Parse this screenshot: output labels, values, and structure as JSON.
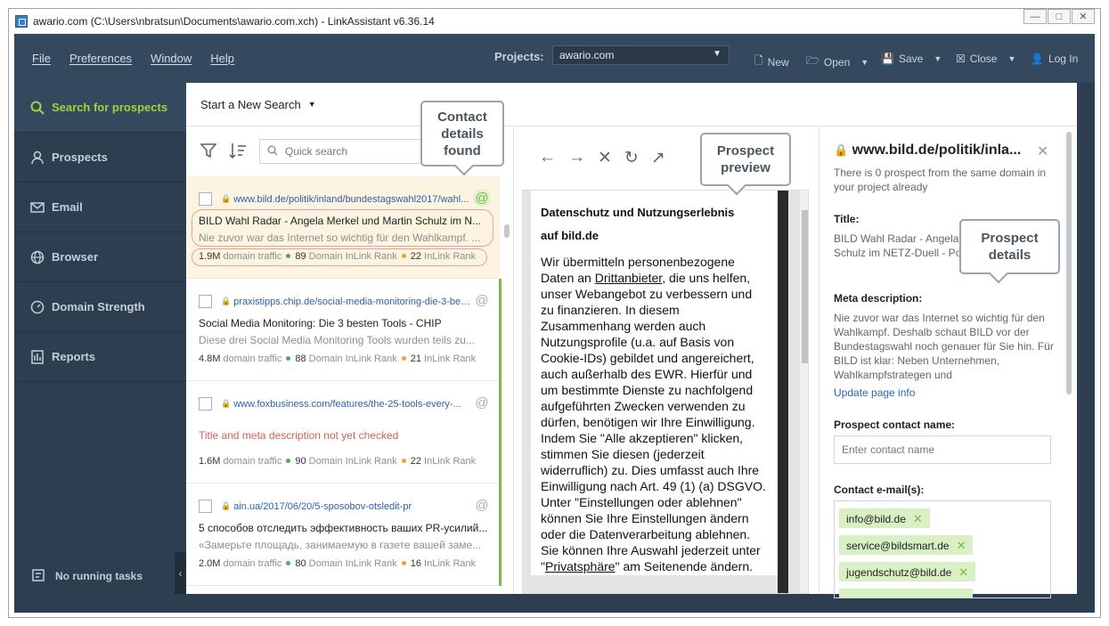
{
  "window": {
    "title": "awario.com (C:\\Users\\nbratsun\\Documents\\awario.com.xch) - LinkAssistant v6.36.14",
    "controls": [
      "min",
      "max",
      "close"
    ]
  },
  "menubar": {
    "items": [
      "File",
      "Preferences",
      "Window",
      "Help"
    ],
    "projects_label": "Projects:",
    "project_value": "awario.com",
    "new": "New",
    "open": "Open",
    "save": "Save",
    "close": "Close",
    "login": "Log In"
  },
  "sidebar": {
    "items": [
      {
        "label": "Search for prospects",
        "icon": "search-icon"
      },
      {
        "label": "Prospects",
        "icon": "user-icon"
      },
      {
        "label": "Email",
        "icon": "mail-icon"
      },
      {
        "label": "Browser",
        "icon": "globe-icon"
      },
      {
        "label": "Domain Strength",
        "icon": "gauge-icon"
      },
      {
        "label": "Reports",
        "icon": "report-icon"
      }
    ],
    "tasks": "No running tasks"
  },
  "search": {
    "new_search": "Start a New Search",
    "placeholder": "Quick search"
  },
  "prospects": [
    {
      "url": "www.bild.de/politik/inland/bundestagswahl2017/wahl...",
      "title": "BILD Wahl Radar - Angela Merkel und Martin Schulz im N...",
      "desc": "Nie zuvor war das Internet so wichtig für den Wahlkampf. ...",
      "traffic": "1.9M",
      "traffic_lbl": "domain traffic",
      "dir": "89",
      "dir_lbl": "Domain InLink Rank",
      "ilr": "22",
      "ilr_lbl": "InLink Rank"
    },
    {
      "url": "praxistipps.chip.de/social-media-monitoring-die-3-best...",
      "title": "Social Media Monitoring: Die 3 besten Tools - CHIP",
      "desc": "Diese drei Social Media Monitoring Tools wurden teils zu...",
      "traffic": "4.8M",
      "traffic_lbl": "domain traffic",
      "dir": "88",
      "dir_lbl": "Domain InLink Rank",
      "ilr": "21",
      "ilr_lbl": "InLink Rank"
    },
    {
      "url": "www.foxbusiness.com/features/the-25-tools-every-...",
      "notchecked": "Title and meta description not yet checked",
      "traffic": "1.6M",
      "traffic_lbl": "domain traffic",
      "dir": "90",
      "dir_lbl": "Domain InLink Rank",
      "ilr": "22",
      "ilr_lbl": "InLink Rank"
    },
    {
      "url": "ain.ua/2017/06/20/5-sposobov-otsledit-pr",
      "title": "5 способов отследить эффективность ваших PR-усилий...",
      "desc": "«Замерьте площадь, занимаемую в газете вашей заме...",
      "traffic": "2.0M",
      "traffic_lbl": "domain traffic",
      "dir": "80",
      "dir_lbl": "Domain InLink Rank",
      "ilr": "16",
      "ilr_lbl": "InLink Rank"
    }
  ],
  "preview": {
    "heading1": "Datenschutz und Nutzungserlebnis",
    "heading2": "auf bild.de",
    "p1_a": "Wir übermitteln personenbezogene Daten an ",
    "p1_link": "Drittanbieter",
    "p1_b": ", die uns helfen, unser Webangebot zu verbessern und zu finanzieren. In diesem Zusammenhang werden auch Nutzungsprofile (u.a. auf Basis von Cookie-IDs) gebildet und angereichert, auch außerhalb des EWR. Hierfür und um bestimmte Dienste zu nachfolgend aufgeführten Zwecken verwenden zu dürfen, benötigen wir Ihre Einwilligung. Indem Sie \"Alle akzeptieren\" klicken, stimmen Sie diesen (jederzeit widerruflich) zu. Dies umfasst auch Ihre Einwilligung nach Art. 49 (1) (a) DSGVO. Unter \"Einstellungen oder ablehnen\" können Sie Ihre Einstellungen ändern oder die Datenverarbeitung ablehnen. Sie können Ihre Auswahl jederzeit unter \"",
    "p1_link2": "Privatsphäre",
    "p1_c": "\" am Seitenende ändern."
  },
  "details": {
    "domain": "www.bild.de/politik/inla...",
    "same_domain": "There is 0 prospect from the same domain in your project already",
    "title_lbl": "Title:",
    "title_val": "BILD Wahl Radar - Angela Merkel und Martin Schulz im NETZ-Duell - Politik Inland - Bild.de",
    "meta_lbl": "Meta description:",
    "meta_val": "Nie zuvor war das Internet so wichtig für den Wahlkampf. Deshalb schaut BILD vor der Bundestagswahl noch genauer für Sie hin. Für BILD ist klar: Neben Unternehmen, Wahlkampfstrategen und",
    "update": "Update page info",
    "contact_lbl": "Prospect contact name:",
    "contact_ph": "Enter contact name",
    "emails_lbl": "Contact e-mail(s):",
    "emails": [
      "info@bild.de",
      "service@bildsmart.de",
      "jugendschutz@bild.de"
    ]
  },
  "callouts": {
    "contact": "Contact details found",
    "preview": "Prospect preview",
    "details": "Prospect details"
  },
  "colors": {
    "accent": "#9ed33b",
    "sidebar": "#2c3e50",
    "link": "#2d5fa8",
    "chip": "#d9efc4"
  }
}
